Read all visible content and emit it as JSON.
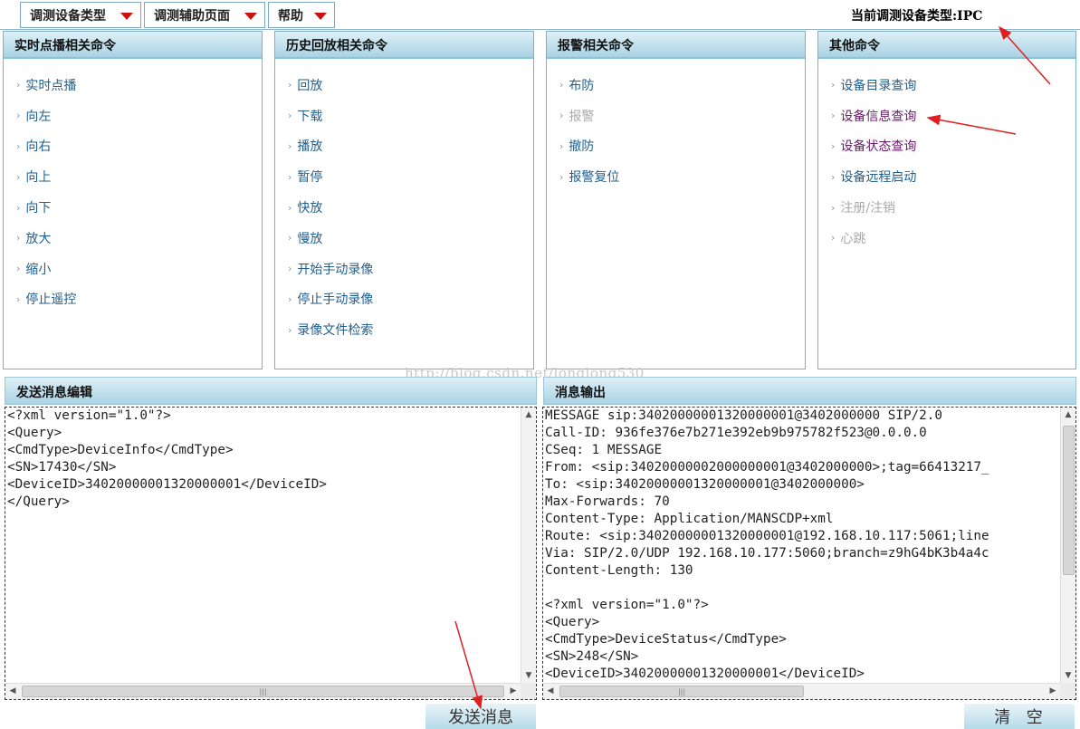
{
  "menubar": {
    "items": [
      {
        "label": "调测设备类型"
      },
      {
        "label": "调测辅助页面"
      },
      {
        "label": "帮助"
      }
    ],
    "current_device_type": "当前调测设备类型:IPC"
  },
  "panels": [
    {
      "title": "实时点播相关命令",
      "commands": [
        {
          "label": "实时点播",
          "state": "normal"
        },
        {
          "label": "向左",
          "state": "normal"
        },
        {
          "label": "向右",
          "state": "normal"
        },
        {
          "label": "向上",
          "state": "normal"
        },
        {
          "label": "向下",
          "state": "normal"
        },
        {
          "label": "放大",
          "state": "normal"
        },
        {
          "label": "缩小",
          "state": "normal"
        },
        {
          "label": "停止遥控",
          "state": "normal"
        }
      ]
    },
    {
      "title": "历史回放相关命令",
      "commands": [
        {
          "label": "回放",
          "state": "normal"
        },
        {
          "label": "下载",
          "state": "normal"
        },
        {
          "label": "播放",
          "state": "normal"
        },
        {
          "label": "暂停",
          "state": "normal"
        },
        {
          "label": "快放",
          "state": "normal"
        },
        {
          "label": "慢放",
          "state": "normal"
        },
        {
          "label": "开始手动录像",
          "state": "normal"
        },
        {
          "label": "停止手动录像",
          "state": "normal"
        },
        {
          "label": "录像文件检索",
          "state": "normal"
        }
      ]
    },
    {
      "title": "报警相关命令",
      "commands": [
        {
          "label": "布防",
          "state": "normal"
        },
        {
          "label": "报警",
          "state": "disabled"
        },
        {
          "label": "撤防",
          "state": "normal"
        },
        {
          "label": "报警复位",
          "state": "normal"
        }
      ]
    },
    {
      "title": "其他命令",
      "commands": [
        {
          "label": "设备目录查询",
          "state": "normal"
        },
        {
          "label": "设备信息查询",
          "state": "visited"
        },
        {
          "label": "设备状态查询",
          "state": "visited"
        },
        {
          "label": "设备远程启动",
          "state": "normal"
        },
        {
          "label": "注册/注销",
          "state": "disabled"
        },
        {
          "label": "心跳",
          "state": "disabled"
        }
      ]
    }
  ],
  "send_editor": {
    "title": "发送消息编辑",
    "content": "<?xml version=\"1.0\"?>\n<Query>\n<CmdType>DeviceInfo</CmdType>\n<SN>17430</SN>\n<DeviceID>34020000001320000001</DeviceID>\n</Query>",
    "button_label": "发送消息"
  },
  "output": {
    "title": "消息输出",
    "content": "MESSAGE sip:34020000001320000001@3402000000 SIP/2.0\nCall-ID: 936fe376e7b271e392eb9b975782f523@0.0.0.0\nCSeq: 1 MESSAGE\nFrom: <sip:34020000002000000001@3402000000>;tag=66413217_\nTo: <sip:34020000001320000001@3402000000>\nMax-Forwards: 70\nContent-Type: Application/MANSCDP+xml\nRoute: <sip:34020000001320000001@192.168.10.117:5061;line\nVia: SIP/2.0/UDP 192.168.10.177:5060;branch=z9hG4bK3b4a4c\nContent-Length: 130\n\n<?xml version=\"1.0\"?>\n<Query>\n<CmdType>DeviceStatus</CmdType>\n<SN>248</SN>\n<DeviceID>34020000001320000001</DeviceID>",
    "button_label": "清  空"
  },
  "watermark": "http://blog.csdn.net/longlong530",
  "icons": {
    "menu_caret": "caret-down-icon",
    "command_bullet": "chevron-right-icon",
    "scroll_up": "scroll-up-arrow-icon",
    "scroll_down": "scroll-down-arrow-icon",
    "scroll_left": "scroll-left-arrow-icon",
    "scroll_right": "scroll-right-arrow-icon"
  },
  "colors": {
    "header_gradient_top": "#dff0f7",
    "header_gradient_bottom": "#a9d2e4",
    "link": "#1f5f8f",
    "link_visited": "#6a1a6a",
    "disabled": "#a9a9a9",
    "caret": "#cc1111",
    "annotation_arrow": "#e02020"
  }
}
